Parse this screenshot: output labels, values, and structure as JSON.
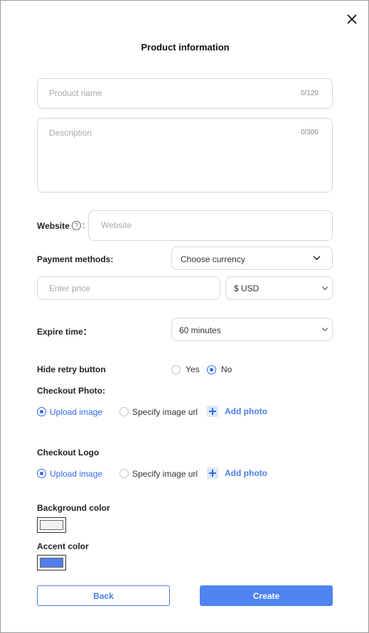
{
  "dialog": {
    "title": "Product information",
    "close_icon": "close-icon"
  },
  "product_name": {
    "placeholder": "Product name",
    "counter": "0/120"
  },
  "description": {
    "placeholder": "Description",
    "counter": "0/300"
  },
  "website": {
    "label": "Website",
    "colon": ":",
    "placeholder": "Website",
    "help_icon": "question-circle-icon",
    "help_glyph": "?"
  },
  "payment": {
    "label": "Payment methods:",
    "currency_select": "Choose currency",
    "price_placeholder": "Enter price",
    "currency_value": "$ USD"
  },
  "expire": {
    "label": "Expire time：",
    "value": "60 minutes"
  },
  "hide_retry": {
    "label": "Hide retry button",
    "options": [
      "Yes",
      "No"
    ],
    "selected": "No"
  },
  "checkout_photo": {
    "label": "Checkout Photo:",
    "options": [
      "Upload image",
      "Specify image url"
    ],
    "selected": "Upload image",
    "add_label": "Add photo"
  },
  "checkout_logo": {
    "label": "Checkout Logo",
    "options": [
      "Upload image",
      "Specify image url"
    ],
    "selected": "Upload image",
    "add_label": "Add photo"
  },
  "colors": {
    "background_label": "Background color",
    "background_value": "#f2f2f2",
    "accent_label": "Accent color",
    "accent_value": "#4f7ff0"
  },
  "actions": {
    "back": "Back",
    "create": "Create"
  },
  "theme": {
    "primary": "#4f84f1",
    "border": "#d6d6d6"
  }
}
